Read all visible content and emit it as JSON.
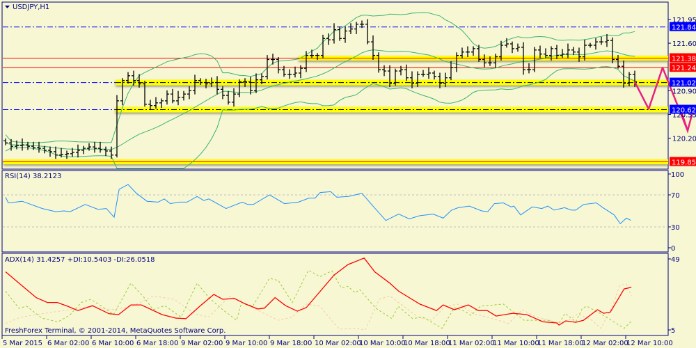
{
  "window": {
    "symbol_title": "USDJPY,H1",
    "copyright": "FreshForex Terminal, © 2001-2014, MetaQuotes Software Corp."
  },
  "colors": {
    "background": "#f7f7d4",
    "frame": "#000080",
    "bar": "#000000",
    "bollinger": "#3cb371",
    "rsi": "#1e90ff",
    "adx": "#ff0000",
    "plus_di": "#9acd32",
    "minus_di": "#f5cba7",
    "support_band": "#ffff00",
    "resistance": "#ff0000",
    "level_blue": "#0000ff",
    "arrow": "#e8207e"
  },
  "chart_data": [
    {
      "type": "ohlc",
      "title": "USDJPY,H1",
      "ylim": [
        119.79,
        122.2
      ],
      "price_ticks": [
        "121.95",
        "121.60",
        "120.90",
        "120.55",
        "120.20"
      ],
      "price_tick_values": [
        121.95,
        121.6,
        120.9,
        120.55,
        120.2
      ],
      "x_ticks": [
        "5 Mar 2015",
        "6 Mar 02:00",
        "6 Mar 10:00",
        "6 Mar 18:00",
        "9 Mar 02:00",
        "9 Mar 10:00",
        "9 Mar 18:00",
        "10 Mar 02:00",
        "10 Mar 10:00",
        "10 Mar 18:00",
        "11 Mar 02:00",
        "11 Mar 10:00",
        "11 Mar 18:00",
        "12 Mar 02:00",
        "12 Mar 10:00"
      ],
      "bars_per_x_tick": 8,
      "bar_spread": 0.035,
      "closes": [
        120.13,
        120.08,
        120.09,
        120.1,
        120.08,
        120.06,
        120.05,
        120.02,
        120.0,
        119.95,
        119.96,
        119.97,
        119.99,
        120.02,
        120.05,
        120.07,
        120.05,
        120.03,
        120.01,
        119.95,
        120.75,
        121.05,
        121.12,
        121.05,
        121.0,
        120.7,
        120.68,
        120.72,
        120.75,
        120.85,
        120.75,
        120.8,
        120.85,
        120.9,
        121.05,
        121.02,
        121.0,
        121.02,
        120.92,
        120.83,
        120.73,
        120.85,
        121.03,
        121.03,
        120.9,
        121.06,
        121.11,
        121.36,
        121.36,
        121.21,
        121.14,
        121.14,
        121.16,
        121.23,
        121.42,
        121.42,
        121.42,
        121.67,
        121.65,
        121.8,
        121.67,
        121.78,
        121.81,
        121.88,
        121.88,
        121.62,
        121.42,
        121.21,
        121.19,
        121.01,
        121.19,
        121.21,
        121.09,
        121.01,
        121.14,
        121.14,
        121.16,
        121.11,
        121.01,
        121.09,
        121.24,
        121.42,
        121.47,
        121.47,
        121.52,
        121.36,
        121.31,
        121.31,
        121.4,
        121.57,
        121.59,
        121.52,
        121.54,
        121.21,
        121.21,
        121.5,
        121.44,
        121.42,
        121.52,
        121.42,
        121.44,
        121.5,
        121.47,
        121.4,
        121.57,
        121.57,
        121.62,
        121.62,
        121.64,
        121.36,
        121.26,
        121.01,
        121.14,
        121.03
      ],
      "bollinger": {
        "period": 20,
        "deviation": 2
      },
      "levels": [
        {
          "price": 121.84,
          "label": "121.84",
          "style": "blue-dashdot",
          "tag": "blue"
        },
        {
          "price": 121.38,
          "label": "121.38",
          "style": "red-band",
          "band_from_bar": 53,
          "tag": "red"
        },
        {
          "price": 121.24,
          "label": "121.24",
          "style": "red",
          "tag": "red"
        },
        {
          "price": 121.02,
          "label": "121.02",
          "style": "dashdot-band",
          "band_from_bar": 20,
          "tag": "blue"
        },
        {
          "price": 120.62,
          "label": "120.62",
          "style": "dashdot-band",
          "band_from_bar": 20,
          "tag": "blue"
        },
        {
          "price": 119.85,
          "label": "119.85",
          "style": "red-band",
          "band_from_bar": 0,
          "tag": "red"
        }
      ],
      "forecast_arrow": [
        [
          113,
          121.03
        ],
        [
          115.5,
          120.63
        ],
        [
          118,
          121.24
        ],
        [
          122.5,
          120.31
        ]
      ]
    },
    {
      "type": "line",
      "title": "RSI(14) 38.2123",
      "ylim": [
        0,
        100
      ],
      "y_ticks": [
        "100",
        "70",
        "30",
        "0"
      ],
      "y_tick_values": [
        100,
        70,
        30,
        0
      ],
      "levels": [
        70,
        30
      ],
      "series": [
        {
          "name": "RSI(14)",
          "points": [
            [
              0,
              67
            ],
            [
              0.5,
              60
            ],
            [
              3,
              62
            ],
            [
              6.6,
              53
            ],
            [
              9,
              49
            ],
            [
              10.5,
              50
            ],
            [
              11.6,
              49
            ],
            [
              14.3,
              58
            ],
            [
              16.6,
              52
            ],
            [
              18.1,
              53
            ],
            [
              19.5,
              42
            ],
            [
              20.4,
              77
            ],
            [
              22,
              83
            ],
            [
              23.5,
              72
            ],
            [
              25.4,
              62
            ],
            [
              27.4,
              61
            ],
            [
              28.5,
              65
            ],
            [
              29.6,
              59
            ],
            [
              31.1,
              61
            ],
            [
              32.6,
              61
            ],
            [
              34.4,
              68
            ],
            [
              35.6,
              63
            ],
            [
              36.5,
              65
            ],
            [
              39.6,
              53
            ],
            [
              42.5,
              61
            ],
            [
              43.5,
              58
            ],
            [
              44.5,
              58
            ],
            [
              47.4,
              70
            ],
            [
              50.1,
              59
            ],
            [
              52.6,
              61
            ],
            [
              54.5,
              66
            ],
            [
              55.6,
              66
            ],
            [
              56.5,
              73
            ],
            [
              58.4,
              74
            ],
            [
              59.5,
              67
            ],
            [
              61.6,
              68
            ],
            [
              64,
              72
            ],
            [
              65.6,
              59
            ],
            [
              68.3,
              38
            ],
            [
              70.6,
              46
            ],
            [
              72.5,
              40
            ],
            [
              74.4,
              44
            ],
            [
              76.8,
              46
            ],
            [
              78.6,
              41
            ],
            [
              80.1,
              51
            ],
            [
              81.3,
              54
            ],
            [
              83.3,
              56
            ],
            [
              85.5,
              50
            ],
            [
              86.6,
              49
            ],
            [
              87.8,
              59
            ],
            [
              89.4,
              60
            ],
            [
              90.8,
              55
            ],
            [
              91.3,
              56
            ],
            [
              92.5,
              45
            ],
            [
              94.6,
              55
            ],
            [
              96.3,
              53
            ],
            [
              97.4,
              56
            ],
            [
              98.5,
              51
            ],
            [
              100.4,
              54
            ],
            [
              101.6,
              51
            ],
            [
              102.4,
              51
            ],
            [
              103.8,
              58
            ],
            [
              106.1,
              60
            ],
            [
              107.3,
              54
            ],
            [
              109.3,
              45
            ],
            [
              110.4,
              34
            ],
            [
              111.5,
              41
            ],
            [
              112.3,
              38.2
            ]
          ]
        }
      ]
    },
    {
      "type": "line",
      "title": "ADX(14) 31.4257 +DI:10.5403 -DI:26.0518",
      "ylim": [
        5,
        49
      ],
      "y_ticks": [
        "49",
        "5"
      ],
      "y_tick_values": [
        49,
        5
      ],
      "series": [
        {
          "name": "ADX",
          "points": [
            [
              0,
              41
            ],
            [
              2.4,
              34
            ],
            [
              5.5,
              25
            ],
            [
              7.5,
              22
            ],
            [
              9.3,
              22
            ],
            [
              11.1,
              19.7
            ],
            [
              13,
              17
            ],
            [
              15.6,
              20
            ],
            [
              18.6,
              15
            ],
            [
              20.3,
              14.5
            ],
            [
              22.5,
              20.5
            ],
            [
              24.4,
              20.5
            ],
            [
              28.1,
              14.5
            ],
            [
              30.6,
              12.3
            ],
            [
              32.4,
              12
            ],
            [
              34.9,
              19.7
            ],
            [
              37.4,
              27
            ],
            [
              39,
              24
            ],
            [
              41.1,
              24.5
            ],
            [
              43.1,
              21
            ],
            [
              45.3,
              18
            ],
            [
              46.5,
              18.5
            ],
            [
              48.4,
              25
            ],
            [
              50.3,
              20
            ],
            [
              52.4,
              16.6
            ],
            [
              54,
              18.8
            ],
            [
              59,
              39
            ],
            [
              61.5,
              45.5
            ],
            [
              64.4,
              49.5
            ],
            [
              66.3,
              41
            ],
            [
              69,
              34
            ],
            [
              70.6,
              29
            ],
            [
              74.4,
              21
            ],
            [
              77.4,
              17
            ],
            [
              78.6,
              20.5
            ],
            [
              80.6,
              17.5
            ],
            [
              83.1,
              20.5
            ],
            [
              84.9,
              17
            ],
            [
              86.5,
              17
            ],
            [
              88.1,
              13.6
            ],
            [
              91.1,
              15.3
            ],
            [
              93.6,
              14.5
            ],
            [
              96.5,
              10
            ],
            [
              99,
              9.3
            ],
            [
              99.4,
              8
            ],
            [
              100.6,
              10.6
            ],
            [
              102.4,
              9.7
            ],
            [
              103.8,
              11
            ],
            [
              106.3,
              17.5
            ],
            [
              107.4,
              15.3
            ],
            [
              108.6,
              16
            ],
            [
              111.1,
              30.4
            ],
            [
              112.4,
              31.4
            ]
          ]
        },
        {
          "name": "+DI",
          "points": [
            [
              0,
              29
            ],
            [
              2.4,
              18.4
            ],
            [
              3.8,
              19.7
            ],
            [
              6.5,
              12.3
            ],
            [
              9.4,
              10
            ],
            [
              11.5,
              14
            ],
            [
              13.6,
              22
            ],
            [
              15.3,
              24
            ],
            [
              16.9,
              20.5
            ],
            [
              19.4,
              14.5
            ],
            [
              22.5,
              34
            ],
            [
              24.9,
              25
            ],
            [
              26.5,
              17.5
            ],
            [
              28.6,
              20
            ],
            [
              31.5,
              13
            ],
            [
              34.4,
              34
            ],
            [
              36.5,
              25
            ],
            [
              39,
              17.5
            ],
            [
              41.5,
              11
            ],
            [
              42.4,
              22
            ],
            [
              44.4,
              19.7
            ],
            [
              47.4,
              37
            ],
            [
              49,
              35.6
            ],
            [
              51.5,
              22
            ],
            [
              54.4,
              42
            ],
            [
              56.5,
              38
            ],
            [
              58.6,
              41.6
            ],
            [
              60.3,
              31
            ],
            [
              61.5,
              32
            ],
            [
              62.8,
              28
            ],
            [
              63.6,
              30
            ],
            [
              66.5,
              18.4
            ],
            [
              69.4,
              12
            ],
            [
              70.5,
              19.7
            ],
            [
              73.1,
              12
            ],
            [
              74.9,
              13
            ],
            [
              78.4,
              6
            ],
            [
              80.6,
              18.8
            ],
            [
              82.4,
              16.6
            ],
            [
              83.6,
              14
            ],
            [
              85.3,
              19.7
            ],
            [
              89.4,
              21
            ],
            [
              93.1,
              11
            ],
            [
              97.4,
              11
            ],
            [
              99.4,
              9
            ],
            [
              100.5,
              15.3
            ],
            [
              102.4,
              10
            ],
            [
              103.6,
              18.4
            ],
            [
              104.4,
              19.7
            ],
            [
              106.9,
              15
            ],
            [
              111.1,
              6
            ],
            [
              112.4,
              10.5
            ]
          ]
        },
        {
          "name": "-DI",
          "points": [
            [
              0,
              9
            ],
            [
              2.8,
              13
            ],
            [
              6.5,
              15
            ],
            [
              11.5,
              17.5
            ],
            [
              15.3,
              19.7
            ],
            [
              19,
              17.5
            ],
            [
              22.8,
              19.7
            ],
            [
              26.5,
              26
            ],
            [
              30.3,
              24
            ],
            [
              34,
              15
            ],
            [
              36.5,
              13
            ],
            [
              40.3,
              26
            ],
            [
              44,
              19.7
            ],
            [
              46.5,
              15
            ],
            [
              49,
              11
            ],
            [
              51.5,
              13
            ],
            [
              54,
              21
            ],
            [
              56.5,
              19.7
            ],
            [
              59,
              9
            ],
            [
              60,
              5.5
            ],
            [
              62.8,
              6
            ],
            [
              64.6,
              5
            ],
            [
              67.1,
              24
            ],
            [
              69,
              26
            ],
            [
              71.5,
              19.7
            ],
            [
              74,
              13
            ],
            [
              76.5,
              11
            ],
            [
              79,
              19.7
            ],
            [
              81.5,
              21
            ],
            [
              84,
              15
            ],
            [
              86.5,
              13
            ],
            [
              90.3,
              9
            ],
            [
              92.8,
              17.5
            ],
            [
              95.3,
              13
            ],
            [
              97.8,
              11
            ],
            [
              100.3,
              9
            ],
            [
              102.8,
              15
            ],
            [
              105.3,
              11
            ],
            [
              106.9,
              6
            ],
            [
              109,
              19.7
            ],
            [
              110.3,
              32.6
            ],
            [
              111.5,
              33.4
            ],
            [
              112.4,
              26
            ]
          ]
        }
      ]
    }
  ]
}
